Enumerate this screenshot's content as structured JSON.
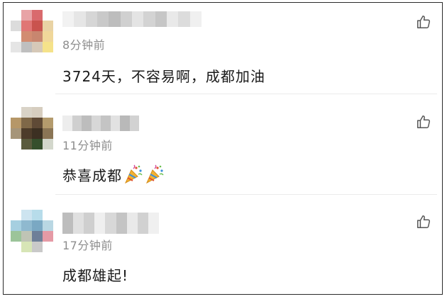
{
  "comments": [
    {
      "time": "8分钟前",
      "text": "3724天，不容易啊，成都加油",
      "avatar_colors": [
        "#ffffff",
        "#e8a3a6",
        "#d96a6d",
        "#ffffff",
        "#dcdcdc",
        "#e07675",
        "#c9534e",
        "#e9d3a4",
        "#ffffff",
        "#d28c71",
        "#c8866f",
        "#f0d79a",
        "#e5e5e5",
        "#bfbfbf",
        "#d6c9b8",
        "#f5e28a"
      ],
      "name_colors": [
        "#f2f2f2",
        "#e6e6e6",
        "#d6d6d6",
        "#c9c9c9",
        "#bdbdbd",
        "#d0d0d0",
        "#e4e4e4",
        "#d3d3d3",
        "#c6c6c6",
        "#e9e9e9",
        "#dcdcdc",
        "#f0f0f0"
      ]
    },
    {
      "time": "11分钟前",
      "text": "恭喜成都",
      "emoji": [
        "party-popper-icon",
        "party-popper-icon"
      ],
      "avatar_colors": [
        "#ffffff",
        "#d9d3c7",
        "#d6cdbf",
        "#ffffff",
        "#b69768",
        "#7f6848",
        "#5f4a36",
        "#b49b6d",
        "#a69579",
        "#4d3c2a",
        "#3c3022",
        "#8a7555",
        "#ffffff",
        "#5a5b3d",
        "#354f2c",
        "#d3d7cc"
      ],
      "name_colors": [
        "#ededed",
        "#cfcfcf",
        "#bdbdbd",
        "#d7d7d7",
        "#c4c4c4",
        "#e2e2e2",
        "#b9b9b9",
        "#d2d2d2"
      ]
    },
    {
      "time": "17分钟前",
      "text": "成都雄起!",
      "avatar_colors": [
        "#ffffff",
        "#cde4f0",
        "#b7dcea",
        "#ffffff",
        "#a6cfe0",
        "#8fb9cf",
        "#7aa8c3",
        "#b9d7e3",
        "#9cc49a",
        "#bfc4b5",
        "#6e7f98",
        "#e59aa5",
        "#ffffff",
        "#d7e5b6",
        "#c9c9c9",
        "#ffffff"
      ],
      "name_colors": [
        "#bdbdbd",
        "#e0e0e0",
        "#cfcfcf",
        "#efefef",
        "#d8d8d8",
        "#c4c4c4",
        "#e9e9e9",
        "#d1d1d1",
        "#f0f0f0"
      ]
    }
  ],
  "colors": {
    "time": "#8d8d8d",
    "text": "#1a1a1a",
    "divider": "#ebebeb",
    "like_icon": "#555555"
  }
}
